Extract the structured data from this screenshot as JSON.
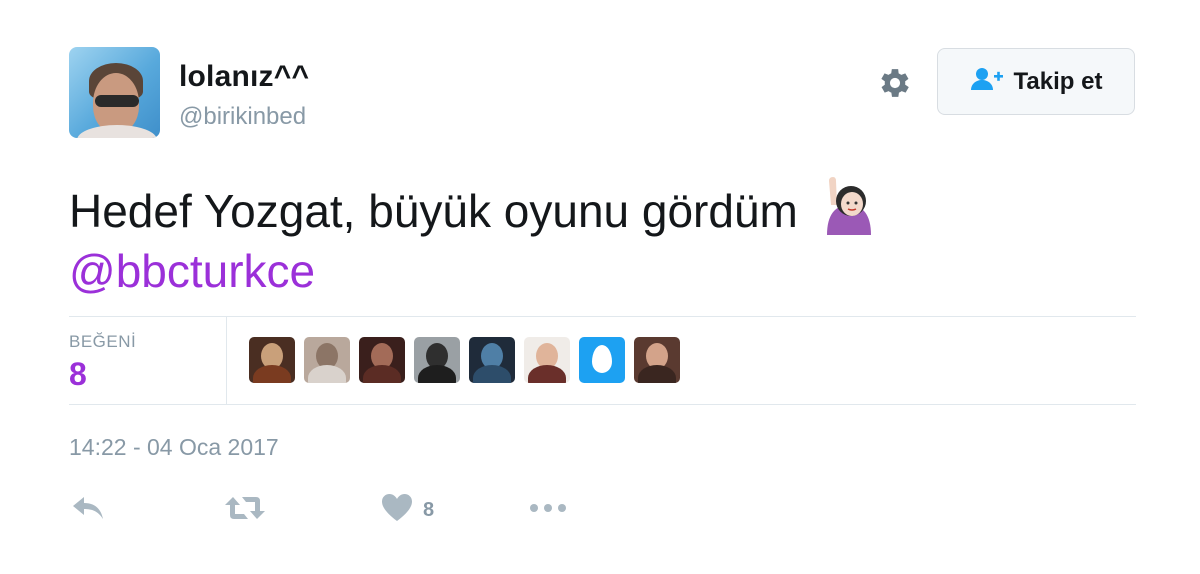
{
  "user": {
    "display_name": "lolanız^^",
    "handle": "@birikinbed",
    "avatar_icon": "user-avatar"
  },
  "header": {
    "settings_icon": "gear-icon",
    "follow_label": "Takip et",
    "follow_icon": "add-user-icon"
  },
  "tweet": {
    "text": "Hedef Yozgat, büyük oyunu gördüm",
    "emoji": "raising-hand-emoji",
    "mention": "@bbcturkce"
  },
  "stats": {
    "likes_label": "BEĞENİ",
    "likes_count": "8",
    "liker_avatars": [
      "liker-1",
      "liker-2",
      "liker-3",
      "liker-4",
      "liker-5",
      "liker-6",
      "liker-default-egg",
      "liker-8"
    ]
  },
  "timestamp": "14:22 - 04 Oca 2017",
  "actions": {
    "reply_icon": "reply-icon",
    "retweet_icon": "retweet-icon",
    "like_icon": "heart-icon",
    "like_count": "8",
    "more_icon": "more-dots-icon"
  },
  "colors": {
    "accent": "#9b30d9",
    "muted": "#8899a6",
    "follow_icon": "#1da1f2",
    "divider": "#e1e8ed",
    "egg_bg": "#1da1f2"
  }
}
